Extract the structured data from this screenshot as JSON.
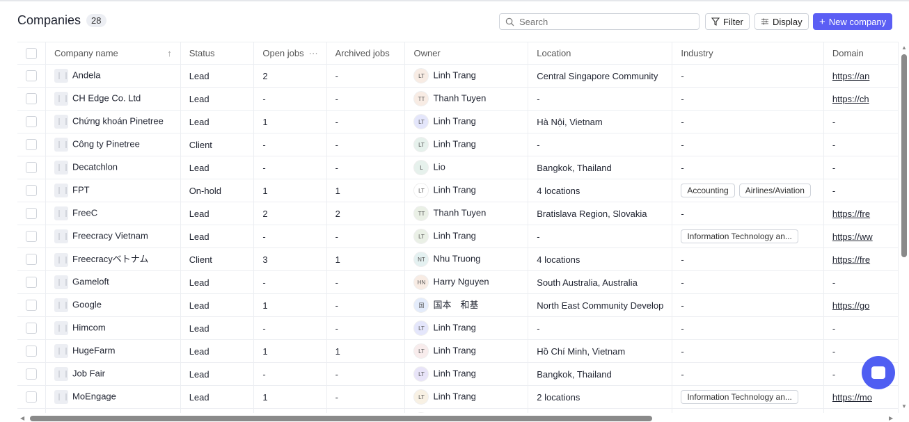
{
  "header": {
    "title": "Companies",
    "count": "28",
    "search_placeholder": "Search",
    "filter": "Filter",
    "display": "Display",
    "new_company": "New company"
  },
  "columns": [
    "Company name",
    "Status",
    "Open jobs",
    "Archived jobs",
    "Owner",
    "Location",
    "Industry",
    "Domain"
  ],
  "rows": [
    {
      "name": "Andela",
      "status": "Lead",
      "open": "2",
      "archived": "-",
      "initials": "LT",
      "owner": "Linh Trang",
      "avatar": "#f8ece4",
      "location": "Central Singapore Community",
      "industry": [],
      "domain": "https://an"
    },
    {
      "name": "CH Edge Co. Ltd",
      "status": "Lead",
      "open": "-",
      "archived": "-",
      "initials": "TT",
      "owner": "Thanh Tuyen",
      "avatar": "#f8ece4",
      "location": "-",
      "industry": [],
      "domain": "https://ch"
    },
    {
      "name": "Chứng khoán Pinetree",
      "status": "Lead",
      "open": "1",
      "archived": "-",
      "initials": "LT",
      "owner": "Linh Trang",
      "avatar": "#e4e6fb",
      "location": "Hà Nội, Vietnam",
      "industry": [],
      "domain": "-"
    },
    {
      "name": "Công ty Pinetree",
      "status": "Client",
      "open": "-",
      "archived": "-",
      "initials": "LT",
      "owner": "Linh Trang",
      "avatar": "#e6f1ec",
      "location": "-",
      "industry": [],
      "domain": "-"
    },
    {
      "name": "Decatchlon",
      "status": "Lead",
      "open": "-",
      "archived": "-",
      "initials": "L",
      "owner": "Lio",
      "avatar": "#e6f1ec",
      "location": "Bangkok, Thailand",
      "industry": [],
      "domain": "-"
    },
    {
      "name": "FPT",
      "status": "On-hold",
      "open": "1",
      "archived": "1",
      "initials": "LT",
      "owner": "Linh Trang",
      "avatar": "#ffffff",
      "location": "4 locations",
      "industry": [
        "Accounting",
        "Airlines/Aviation"
      ],
      "domain": "-"
    },
    {
      "name": "FreeC",
      "status": "Lead",
      "open": "2",
      "archived": "2",
      "initials": "TT",
      "owner": "Thanh Tuyen",
      "avatar": "#eaf0e6",
      "location": "Bratislava Region, Slovakia",
      "industry": [],
      "domain": "https://fre"
    },
    {
      "name": "Freecracy Vietnam",
      "status": "Lead",
      "open": "-",
      "archived": "-",
      "initials": "LT",
      "owner": "Linh Trang",
      "avatar": "#eaf0e6",
      "location": "-",
      "industry": [
        "Information Technology an..."
      ],
      "domain": "https://ww"
    },
    {
      "name": "Freecracyベトナム",
      "status": "Client",
      "open": "3",
      "archived": "1",
      "initials": "NT",
      "owner": "Nhu Truong",
      "avatar": "#e4f1f1",
      "location": "4 locations",
      "industry": [],
      "domain": "https://fre"
    },
    {
      "name": "Gameloft",
      "status": "Lead",
      "open": "-",
      "archived": "-",
      "initials": "HN",
      "owner": "Harry Nguyen",
      "avatar": "#f8ece4",
      "location": "South Australia, Australia",
      "industry": [],
      "domain": "-"
    },
    {
      "name": "Google",
      "status": "Lead",
      "open": "1",
      "archived": "-",
      "initials": "国",
      "owner": "国本　和基",
      "avatar": "#e4ecfb",
      "location": "North East Community Develop",
      "industry": [],
      "domain": "https://go"
    },
    {
      "name": "Himcom",
      "status": "Lead",
      "open": "-",
      "archived": "-",
      "initials": "LT",
      "owner": "Linh Trang",
      "avatar": "#e4e6fb",
      "location": "-",
      "industry": [],
      "domain": "-"
    },
    {
      "name": "HugeFarm",
      "status": "Lead",
      "open": "1",
      "archived": "1",
      "initials": "LT",
      "owner": "Linh Trang",
      "avatar": "#f8ecec",
      "location": "Hồ Chí Minh, Vietnam",
      "industry": [],
      "domain": "-"
    },
    {
      "name": "Job Fair",
      "status": "Lead",
      "open": "-",
      "archived": "-",
      "initials": "LT",
      "owner": "Linh Trang",
      "avatar": "#e8e4f8",
      "location": "Bangkok, Thailand",
      "industry": [],
      "domain": "-"
    },
    {
      "name": "MoEngage",
      "status": "Lead",
      "open": "1",
      "archived": "-",
      "initials": "LT",
      "owner": "Linh Trang",
      "avatar": "#f8f1e4",
      "location": "2 locations",
      "industry": [
        "Information Technology an..."
      ],
      "domain": "https://mo"
    },
    {
      "name": "",
      "status": "",
      "open": "",
      "archived": "",
      "initials": "",
      "owner": "",
      "avatar": "#e4ecfb",
      "location": "",
      "industry": [],
      "domain": ""
    }
  ]
}
